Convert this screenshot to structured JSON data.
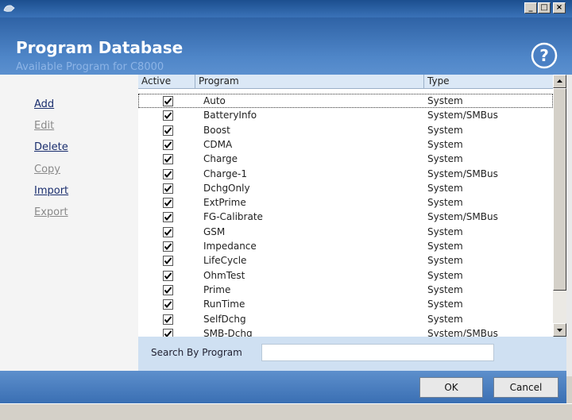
{
  "header": {
    "title": "Program Database",
    "subtitle": "Available Program for C8000"
  },
  "window_buttons": {
    "minimize": "_",
    "maximize": "□",
    "close": "×"
  },
  "actions": [
    {
      "label": "Add",
      "enabled": true
    },
    {
      "label": "Edit",
      "enabled": false
    },
    {
      "label": "Delete",
      "enabled": true
    },
    {
      "label": "Copy",
      "enabled": false
    },
    {
      "label": "Import",
      "enabled": true
    },
    {
      "label": "Export",
      "enabled": false
    }
  ],
  "table": {
    "columns": [
      "Active",
      "Program",
      "Type"
    ],
    "rows": [
      {
        "active": true,
        "program": "Auto",
        "type": "System"
      },
      {
        "active": true,
        "program": "BatteryInfo",
        "type": "System/SMBus"
      },
      {
        "active": true,
        "program": "Boost",
        "type": "System"
      },
      {
        "active": true,
        "program": "CDMA",
        "type": "System"
      },
      {
        "active": true,
        "program": "Charge",
        "type": "System"
      },
      {
        "active": true,
        "program": "Charge-1",
        "type": "System/SMBus"
      },
      {
        "active": true,
        "program": "DchgOnly",
        "type": "System"
      },
      {
        "active": true,
        "program": "ExtPrime",
        "type": "System"
      },
      {
        "active": true,
        "program": "FG-Calibrate",
        "type": "System/SMBus"
      },
      {
        "active": true,
        "program": "GSM",
        "type": "System"
      },
      {
        "active": true,
        "program": "Impedance",
        "type": "System"
      },
      {
        "active": true,
        "program": "LifeCycle",
        "type": "System"
      },
      {
        "active": true,
        "program": "OhmTest",
        "type": "System"
      },
      {
        "active": true,
        "program": "Prime",
        "type": "System"
      },
      {
        "active": true,
        "program": "RunTime",
        "type": "System"
      },
      {
        "active": true,
        "program": "SelfDchg",
        "type": "System"
      },
      {
        "active": true,
        "program": "SMB-Dchg",
        "type": "System/SMBus"
      }
    ]
  },
  "search": {
    "label": "Search By Program",
    "value": ""
  },
  "footer": {
    "ok_label": "OK",
    "cancel_label": "Cancel"
  }
}
